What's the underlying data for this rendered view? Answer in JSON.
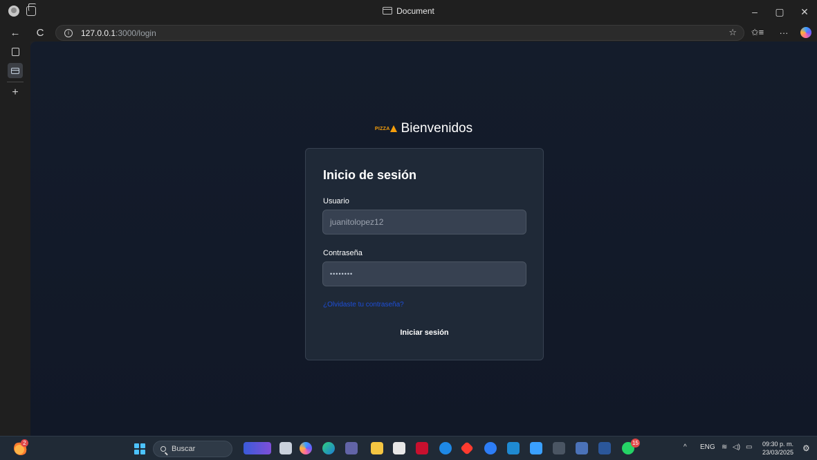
{
  "window": {
    "title": "Document",
    "controls": {
      "minimize": "–",
      "maximize": "▢",
      "close": "✕"
    }
  },
  "navigation": {
    "back": "←",
    "reload": "C",
    "url_host": "127.0.0.1",
    "url_path": ":3000/login",
    "favorite_icon": "☆",
    "favorites_icon": "✩≡",
    "more_icon": "···"
  },
  "sidebar": {
    "new_tab": "+"
  },
  "page": {
    "logo_text": "PIZZA",
    "welcome": "Bienvenidos",
    "form": {
      "title": "Inicio de sesión",
      "username_label": "Usuario",
      "username_value": "juanitolopez12",
      "password_label": "Contraseña",
      "password_value": "••••••••",
      "forgot_link": "¿Olvidaste tu contraseña?",
      "submit_label": "Iniciar sesión"
    }
  },
  "taskbar": {
    "weather_badge": "2",
    "search_placeholder": "Buscar",
    "whatsapp_badge": "15",
    "tray_chevron": "^",
    "language": "ENG",
    "time": "09:30 p. m.",
    "date": "23/03/2025"
  },
  "colors": {
    "page_bg": "#111827",
    "card_bg": "#1f2937",
    "input_bg": "#374151",
    "link": "#1d4ed8",
    "logo": "#f59e0b"
  }
}
